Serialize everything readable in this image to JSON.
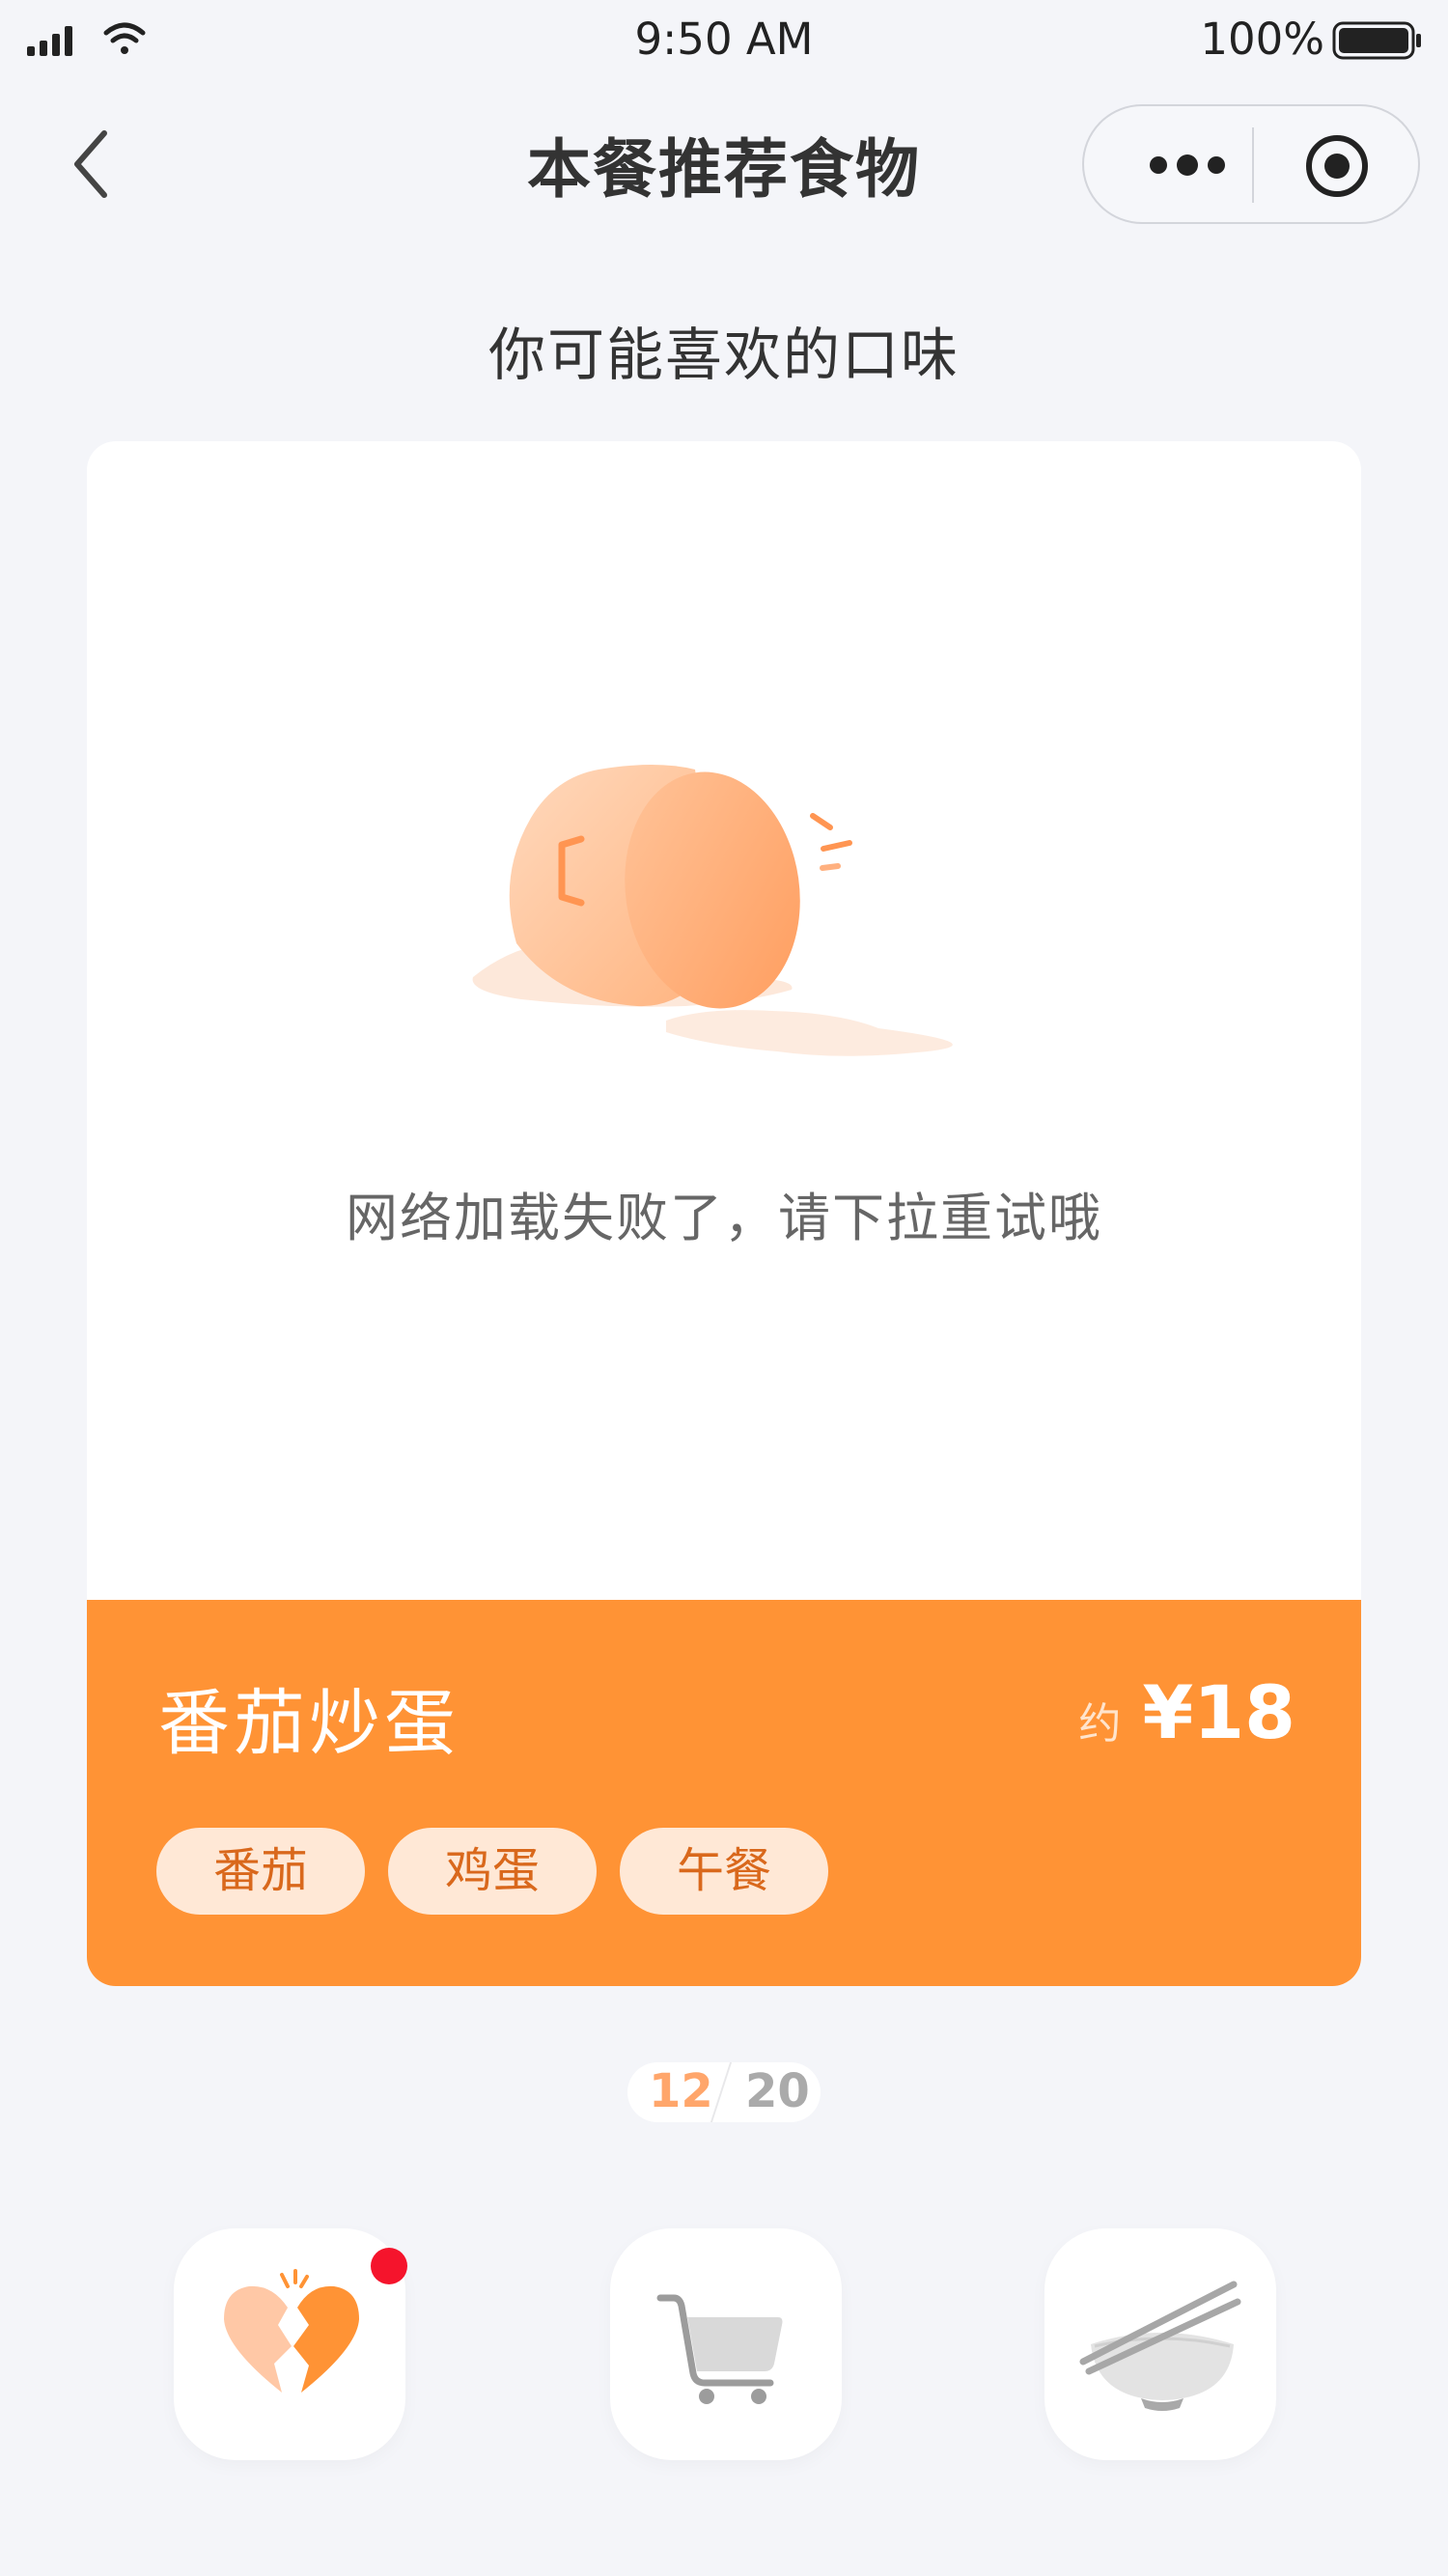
{
  "status_bar": {
    "time": "9:50 AM",
    "battery_percent": "100%"
  },
  "nav": {
    "title": "本餐推荐食物"
  },
  "section_title": "你可能喜欢的口味",
  "card": {
    "error_message": "网络加载失败了，请下拉重试哦",
    "food_name": "番茄炒蛋",
    "price_prefix": "约",
    "price": "¥18",
    "tags": [
      "番茄",
      "鸡蛋",
      "午餐"
    ]
  },
  "pager": {
    "current": "12",
    "total": "20"
  },
  "colors": {
    "accent": "#ff9335",
    "tag_bg": "#ffe8d6",
    "tag_text": "#d9681c",
    "notification_dot": "#f5142c",
    "background": "#f4f5f9"
  },
  "icons": {
    "like": "broken-heart-icon",
    "cart": "shopping-cart-icon",
    "meal": "bowl-chopsticks-icon"
  }
}
